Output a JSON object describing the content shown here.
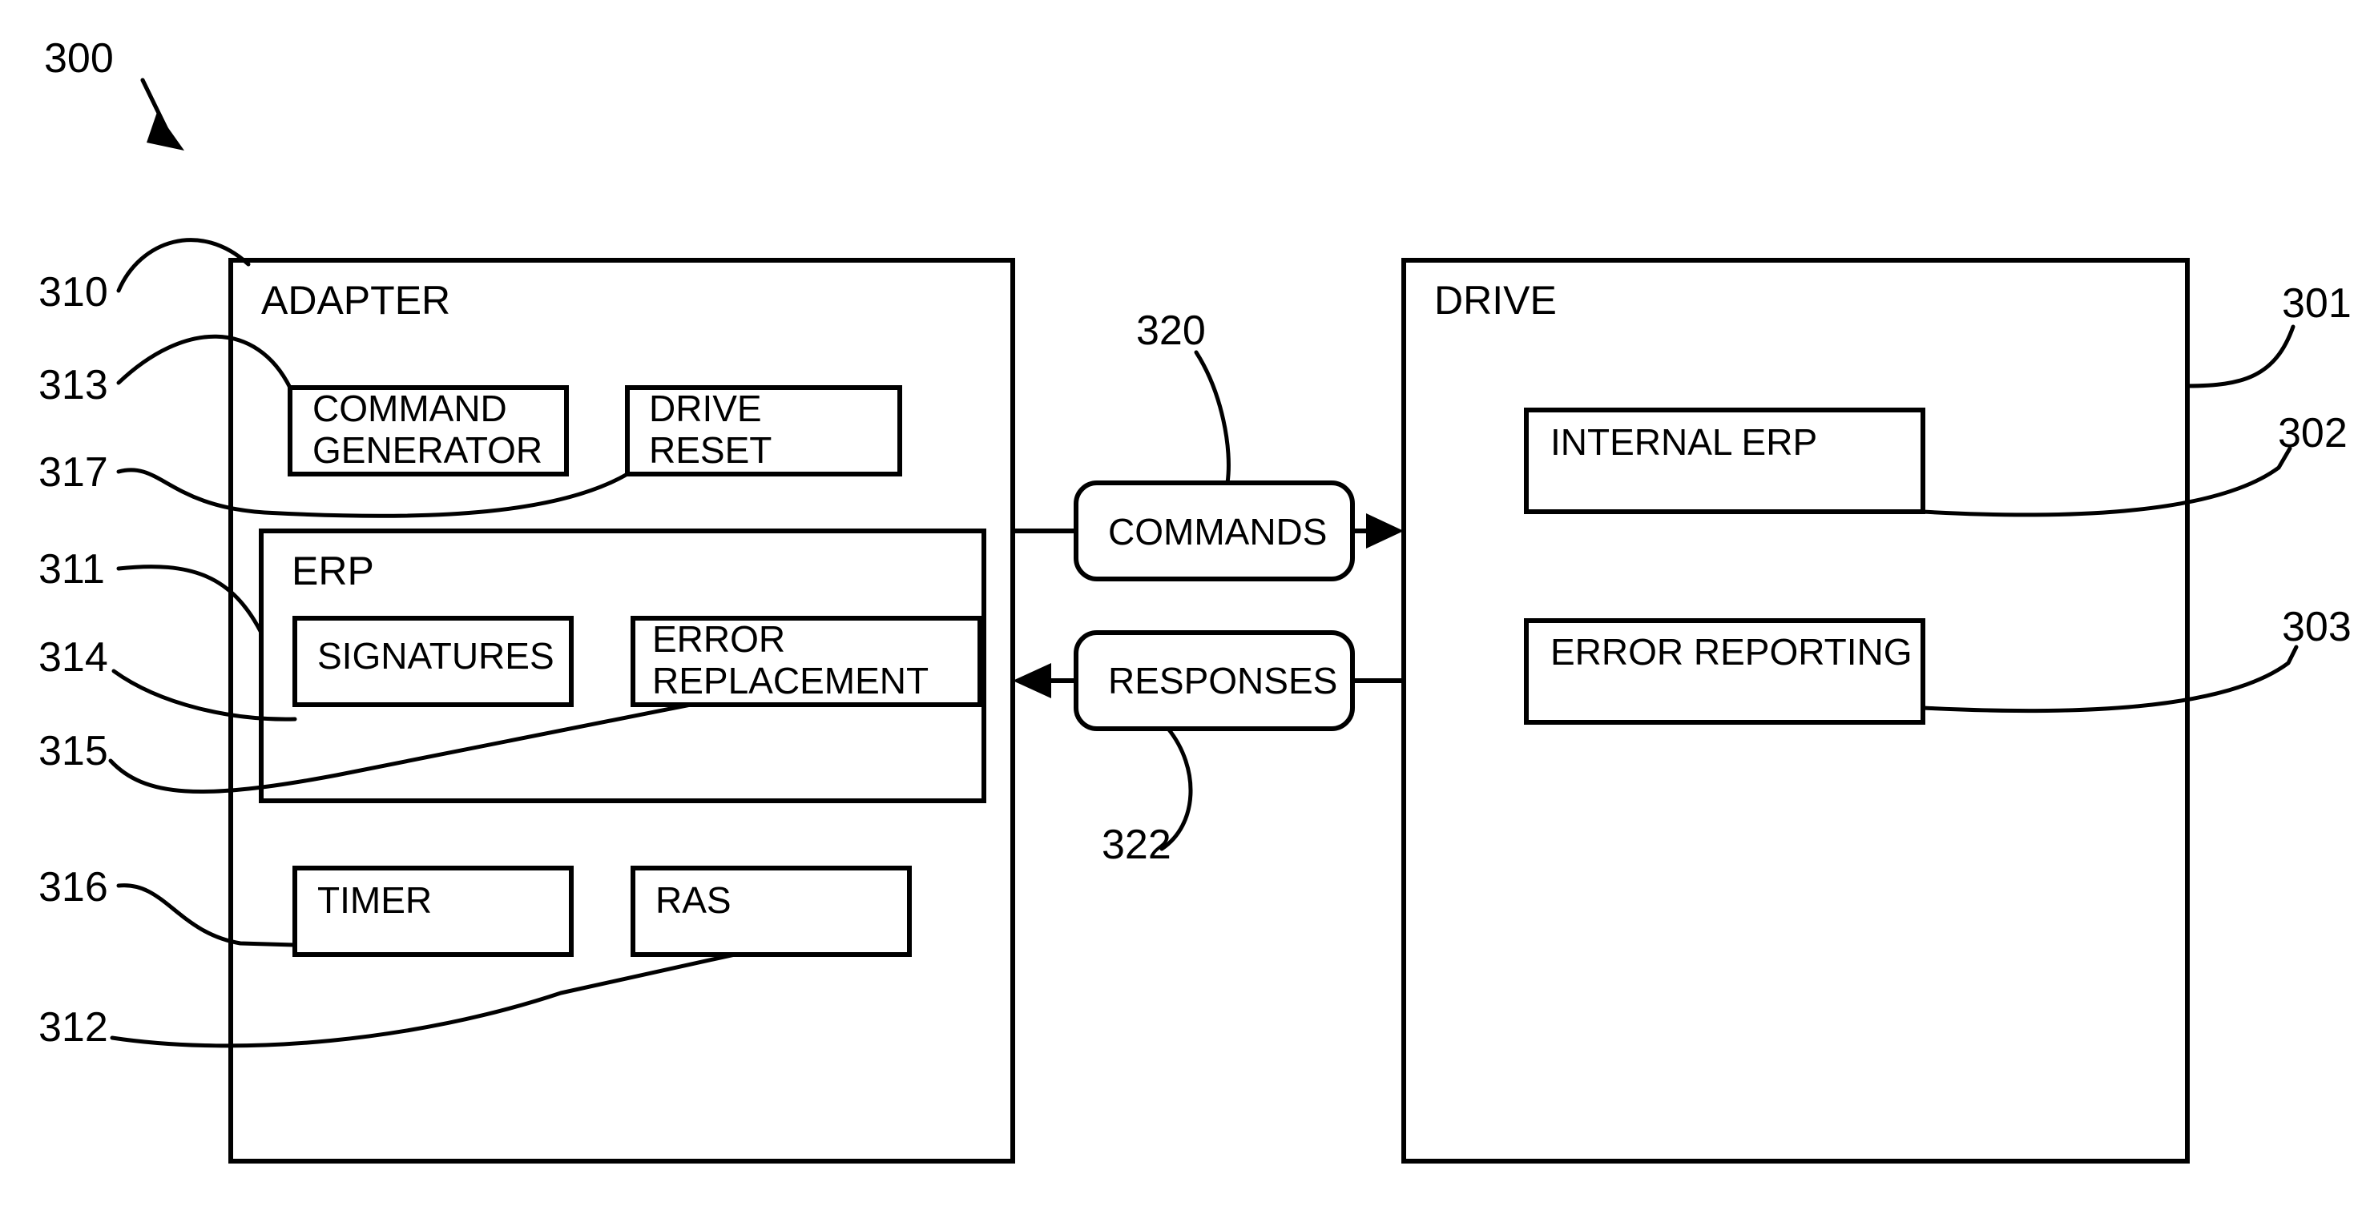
{
  "figure": {
    "number": "300",
    "type": "patent-block-diagram"
  },
  "reference_numerals": {
    "figure": "300",
    "adapter": "310",
    "command_generator": "313",
    "drive_reset": "317",
    "erp": "311",
    "signatures": "314",
    "error_replacement": "315",
    "timer": "316",
    "ras": "312",
    "commands": "320",
    "responses": "322",
    "drive": "301",
    "internal_erp": "302",
    "error_reporting": "303"
  },
  "adapter": {
    "title": "ADAPTER",
    "ref": "310",
    "blocks": [
      {
        "label": "COMMAND GENERATOR",
        "line1": "COMMAND",
        "line2": "GENERATOR",
        "ref": "313"
      },
      {
        "label": "DRIVE RESET",
        "line1": "DRIVE",
        "line2": "RESET",
        "ref": "317"
      },
      {
        "label": "TIMER",
        "line1": "TIMER",
        "line2": "",
        "ref": "316"
      },
      {
        "label": "RAS",
        "line1": "RAS",
        "line2": "",
        "ref": "312"
      }
    ],
    "erp": {
      "title": "ERP",
      "ref": "311",
      "blocks": [
        {
          "label": "SIGNATURES",
          "line1": "SIGNATURES",
          "line2": "",
          "ref": "314"
        },
        {
          "label": "ERROR REPLACEMENT",
          "line1": "ERROR",
          "line2": "REPLACEMENT",
          "ref": "315"
        }
      ]
    }
  },
  "drive": {
    "title": "DRIVE",
    "ref": "301",
    "blocks": [
      {
        "label": "INTERNAL ERP",
        "line1": "INTERNAL ERP",
        "ref": "302"
      },
      {
        "label": "ERROR REPORTING",
        "line1": "ERROR REPORTING",
        "ref": "303"
      }
    ]
  },
  "channels": [
    {
      "label": "COMMANDS",
      "ref": "320",
      "direction": "adapter-to-drive"
    },
    {
      "label": "RESPONSES",
      "ref": "322",
      "direction": "drive-to-adapter"
    }
  ],
  "colors": {
    "line": "#000000",
    "background": "#ffffff"
  }
}
